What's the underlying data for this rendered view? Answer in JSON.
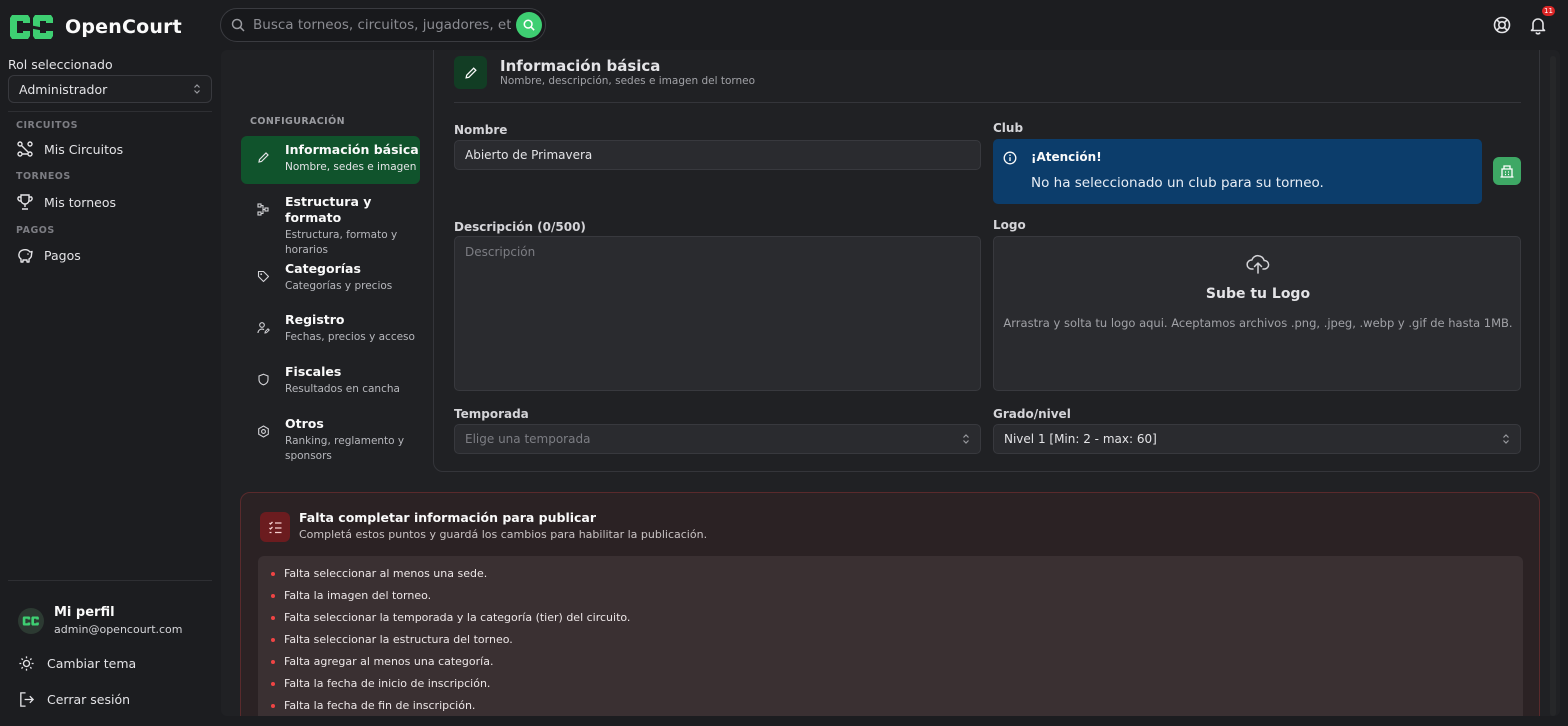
{
  "app": {
    "name": "OpenCourt"
  },
  "search": {
    "placeholder": "Busca torneos, circuitos, jugadores, etc."
  },
  "notifications": {
    "count": "11"
  },
  "sidebar": {
    "role_label": "Rol seleccionado",
    "role_value": "Administrador",
    "sections": [
      {
        "title": "CIRCUITOS",
        "item": "Mis Circuitos",
        "icon": "circuit-icon"
      },
      {
        "title": "TORNEOS",
        "item": "Mis torneos",
        "icon": "trophy-icon"
      },
      {
        "title": "PAGOS",
        "item": "Pagos",
        "icon": "piggy-bank-icon"
      }
    ],
    "profile": {
      "name": "Mi perfil",
      "email": "admin@opencourt.com"
    },
    "theme_label": "Cambiar tema",
    "logout_label": "Cerrar sesión"
  },
  "config_nav": {
    "title": "CONFIGURACIÓN",
    "items": [
      {
        "title": "Información básica",
        "subtitle": "Nombre, sedes e imagen",
        "active": true
      },
      {
        "title": "Estructura y formato",
        "subtitle": "Estructura, formato y horarios"
      },
      {
        "title": "Categorías",
        "subtitle": "Categorías y precios"
      },
      {
        "title": "Registro",
        "subtitle": "Fechas, precios y acceso"
      },
      {
        "title": "Fiscales",
        "subtitle": "Resultados en cancha"
      },
      {
        "title": "Otros",
        "subtitle": "Ranking, reglamento y sponsors"
      }
    ]
  },
  "basic_info": {
    "title": "Información básica",
    "subtitle": "Nombre, descripción, sedes e imagen del torneo",
    "name_label": "Nombre",
    "name_value": "Abierto de Primavera",
    "club_label": "Club",
    "club_alert_title": "¡Atención!",
    "club_alert_text": "No ha seleccionado un club para su torneo.",
    "description_label": "Descripción (0/500)",
    "description_placeholder": "Descripción",
    "logo_label": "Logo",
    "logo_title": "Sube tu Logo",
    "logo_text": "Arrastra y solta tu logo aqui. Aceptamos archivos .png, .jpeg, .webp y .gif de hasta 1MB.",
    "season_label": "Temporada",
    "season_placeholder": "Elige una temporada",
    "grade_label": "Grado/nivel",
    "grade_value": "Nivel 1 [Min: 2 - max: 60]"
  },
  "publish_warning": {
    "title": "Falta completar información para publicar",
    "subtitle": "Completá estos puntos y guardá los cambios para habilitar la publicación.",
    "items": [
      "Falta seleccionar al menos una sede.",
      "Falta la imagen del torneo.",
      "Falta seleccionar la temporada y la categoría (tier) del circuito.",
      "Falta seleccionar la estructura del torneo.",
      "Falta agregar al menos una categoría.",
      "Falta la fecha de inicio de inscripción.",
      "Falta la fecha de fin de inscripción."
    ]
  },
  "colors": {
    "accent": "#3ecf72",
    "active_nav": "#10532c",
    "alert_bg": "#0c3d6b",
    "warning_bg": "#2b2224"
  }
}
